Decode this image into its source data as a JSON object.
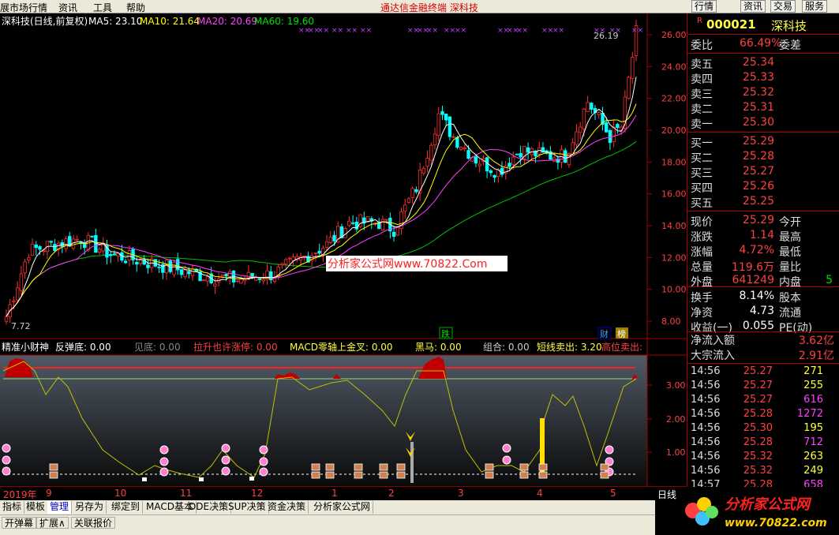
{
  "menubar": {
    "items": [
      "展市场行情",
      "资讯",
      "工具",
      "帮助"
    ],
    "center_title": "通达信金融终端  深科技",
    "right_buttons": [
      "行情",
      "资讯",
      "交易",
      "服务"
    ]
  },
  "main_chart": {
    "header": {
      "name": "深科技(日线,前复权)",
      "ma5": "MA5: 23.10",
      "ma10": "MA10: 21.64",
      "ma20": "MA20: 20.69",
      "ma60": "MA60: 19.60"
    },
    "watermark": "分析家公式网www.70822.Com",
    "high_label": "26.19",
    "low_label": "7.72",
    "event_labels": [
      "跌",
      "财",
      "榜"
    ],
    "y_axis_ticks": [
      "26.00",
      "24.00",
      "22.00",
      "20.00",
      "18.00",
      "16.00",
      "14.00",
      "12.00",
      "10.00",
      "8.00"
    ],
    "colors": {
      "ma5": "#ffffff",
      "ma10": "#ffff00",
      "ma20": "#ff40ff",
      "ma60": "#00c000",
      "up": "#ff3030",
      "down": "#00ffff"
    }
  },
  "indicator": {
    "name": "精准小财神",
    "fields": [
      {
        "label": "反弹底: 0.00",
        "color": "#ffffff"
      },
      {
        "label": "见底: 0.00",
        "color": "#888888"
      },
      {
        "label": "拉升也许涨停: 0.00",
        "color": "#ff4040"
      },
      {
        "label": "MACD零轴上金叉: 0.00",
        "color": "#ffff40"
      },
      {
        "label": "黑马: 0.00",
        "color": "#ffff40"
      },
      {
        "label": "组合: 0.00",
        "color": "#cccccc"
      },
      {
        "label": "短线卖出: 3.20",
        "color": "#ffff40"
      },
      {
        "label": "高位卖出: ",
        "color": "#ff4040"
      }
    ],
    "y_axis_ticks": [
      "3.00",
      "2.00",
      "1.00"
    ]
  },
  "date_axis": {
    "labels": [
      "2019年",
      "9",
      "10",
      "11",
      "12",
      "1",
      "2",
      "3",
      "4",
      "5"
    ],
    "period": "日线"
  },
  "tabs": [
    "指标",
    "模板",
    "管理",
    "另存为",
    "绑定到",
    "MACD基本",
    "DDE决策",
    "SUP决策",
    "资金决策",
    "分析家公式网"
  ],
  "active_tab": "管理",
  "statusbar": [
    "开弹幕",
    "扩展∧",
    "关联报价"
  ],
  "quote_panel": {
    "marker": "R",
    "code": "000021",
    "name": "深科技",
    "weibi_label": "委比",
    "weibi_value": "66.49%",
    "weicha_label": "委差",
    "asks": [
      {
        "label": "卖五",
        "price": "25.34"
      },
      {
        "label": "卖四",
        "price": "25.33"
      },
      {
        "label": "卖三",
        "price": "25.32"
      },
      {
        "label": "卖二",
        "price": "25.31"
      },
      {
        "label": "卖一",
        "price": "25.30"
      }
    ],
    "bids": [
      {
        "label": "买一",
        "price": "25.29"
      },
      {
        "label": "买二",
        "price": "25.28"
      },
      {
        "label": "买三",
        "price": "25.27"
      },
      {
        "label": "买四",
        "price": "25.26"
      },
      {
        "label": "买五",
        "price": "25.25"
      }
    ],
    "stats": [
      {
        "label": "现价",
        "value": "25.29",
        "label2": "今开"
      },
      {
        "label": "涨跌",
        "value": "1.14",
        "label2": "最高"
      },
      {
        "label": "涨幅",
        "value": "4.72%",
        "label2": "最低"
      },
      {
        "label": "总量",
        "value": "119.6万",
        "label2": "量比"
      },
      {
        "label": "外盘",
        "value": "641249",
        "label2": "内盘",
        "extra": "5"
      }
    ],
    "fundamentals": [
      {
        "label": "换手",
        "value": "8.14%",
        "label2": "股本"
      },
      {
        "label": "净资",
        "value": "4.73",
        "label2": "流通"
      },
      {
        "label": "收益(一)",
        "value": "0.055",
        "label2": "PE(动)"
      }
    ],
    "flows": [
      {
        "label": "净流入额",
        "value": "3.62亿"
      },
      {
        "label": "大宗流入",
        "value": "2.91亿"
      }
    ],
    "ticks": [
      {
        "time": "14:56",
        "price": "25.27",
        "vol": "271",
        "volcolor": "#ffff40"
      },
      {
        "time": "14:56",
        "price": "25.27",
        "vol": "255",
        "volcolor": "#ffff40"
      },
      {
        "time": "14:56",
        "price": "25.27",
        "vol": "616",
        "volcolor": "#ff40ff"
      },
      {
        "time": "14:56",
        "price": "25.28",
        "vol": "1272",
        "volcolor": "#ff40ff"
      },
      {
        "time": "14:56",
        "price": "25.30",
        "vol": "195",
        "volcolor": "#ffff40"
      },
      {
        "time": "14:56",
        "price": "25.28",
        "vol": "712",
        "volcolor": "#ff40ff"
      },
      {
        "time": "14:56",
        "price": "25.32",
        "vol": "263",
        "volcolor": "#ffff40"
      },
      {
        "time": "14:56",
        "price": "25.32",
        "vol": "249",
        "volcolor": "#ffff40"
      },
      {
        "time": "14:57",
        "price": "25.28",
        "vol": "658",
        "volcolor": "#ff40ff"
      }
    ]
  },
  "logo": {
    "text": "分析家公式网",
    "url": "www.70822.com"
  }
}
